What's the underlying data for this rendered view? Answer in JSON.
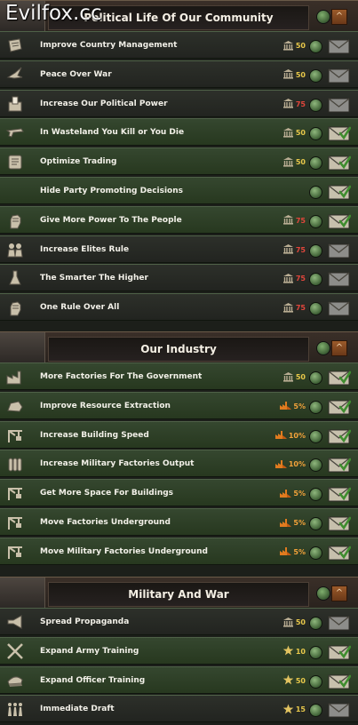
{
  "watermark": "Evilfox.cc",
  "sections": [
    {
      "title": "Political Life Of Our Community",
      "toggle_label": "^",
      "decisions": [
        {
          "label": "Improve Country Management",
          "icon": "scroll-icon",
          "cost_icon": "political-power-icon",
          "cost": "50",
          "cost_color": "yellow",
          "accepted": false
        },
        {
          "label": "Peace Over War",
          "icon": "dove-icon",
          "cost_icon": "political-power-icon",
          "cost": "50",
          "cost_color": "yellow",
          "accepted": false
        },
        {
          "label": "Increase Our Political Power",
          "icon": "ballot-icon",
          "cost_icon": "political-power-icon",
          "cost": "75",
          "cost_color": "red",
          "accepted": false
        },
        {
          "label": "In Wasteland You Kill or You Die",
          "icon": "gun-icon",
          "cost_icon": "political-power-icon",
          "cost": "50",
          "cost_color": "yellow",
          "accepted": true
        },
        {
          "label": "Optimize Trading",
          "icon": "trade-icon",
          "cost_icon": "political-power-icon",
          "cost": "50",
          "cost_color": "yellow",
          "accepted": true
        },
        {
          "label": "Hide Party Promoting Decisions",
          "icon": "",
          "cost_icon": "",
          "cost": "",
          "cost_color": "yellow",
          "accepted": true
        },
        {
          "label": "Give More Power To The People",
          "icon": "fist-icon",
          "cost_icon": "political-power-icon",
          "cost": "75",
          "cost_color": "red",
          "accepted": true
        },
        {
          "label": "Increase Elites Rule",
          "icon": "people-icon",
          "cost_icon": "political-power-icon",
          "cost": "75",
          "cost_color": "red",
          "accepted": false
        },
        {
          "label": "The Smarter The Higher",
          "icon": "flask-icon",
          "cost_icon": "political-power-icon",
          "cost": "75",
          "cost_color": "red",
          "accepted": false
        },
        {
          "label": "One Rule Over All",
          "icon": "fist-icon",
          "cost_icon": "political-power-icon",
          "cost": "75",
          "cost_color": "red",
          "accepted": false
        }
      ]
    },
    {
      "title": "Our Industry",
      "toggle_label": "^",
      "decisions": [
        {
          "label": "More Factories For The Government",
          "icon": "factory-icon",
          "cost_icon": "political-power-icon",
          "cost": "50",
          "cost_color": "yellow",
          "accepted": true
        },
        {
          "label": "Improve Resource Extraction",
          "icon": "ore-icon",
          "cost_icon": "factory-cost-icon",
          "cost": "5%",
          "cost_color": "orange",
          "accepted": true
        },
        {
          "label": "Increase Building Speed",
          "icon": "crane-icon",
          "cost_icon": "factory-cost-icon",
          "cost": "10%",
          "cost_color": "orange",
          "accepted": true
        },
        {
          "label": "Increase Military Factories Output",
          "icon": "shells-icon",
          "cost_icon": "factory-cost-icon",
          "cost": "10%",
          "cost_color": "orange",
          "accepted": true
        },
        {
          "label": "Get More Space For Buildings",
          "icon": "crane-icon",
          "cost_icon": "factory-cost-icon",
          "cost": "5%",
          "cost_color": "orange",
          "accepted": true
        },
        {
          "label": "Move Factories Underground",
          "icon": "crane-icon",
          "cost_icon": "factory-cost-icon",
          "cost": "5%",
          "cost_color": "orange",
          "accepted": true
        },
        {
          "label": "Move Military Factories Underground",
          "icon": "crane-icon",
          "cost_icon": "factory-cost-icon",
          "cost": "5%",
          "cost_color": "orange",
          "accepted": true
        }
      ]
    },
    {
      "title": "Military And War",
      "toggle_label": "^",
      "decisions": [
        {
          "label": "Spread Propaganda",
          "icon": "megaphone-icon",
          "cost_icon": "political-power-icon",
          "cost": "50",
          "cost_color": "yellow",
          "accepted": false
        },
        {
          "label": "Expand Army Training",
          "icon": "swords-icon",
          "cost_icon": "army-xp-icon",
          "cost": "10",
          "cost_color": "yellow",
          "accepted": true
        },
        {
          "label": "Expand Officer Training",
          "icon": "officer-cap-icon",
          "cost_icon": "army-xp-icon",
          "cost": "50",
          "cost_color": "yellow",
          "accepted": true
        },
        {
          "label": "Immediate Draft",
          "icon": "soldiers-icon",
          "cost_icon": "army-xp-icon",
          "cost": "15",
          "cost_color": "yellow",
          "accepted": false
        }
      ]
    }
  ]
}
